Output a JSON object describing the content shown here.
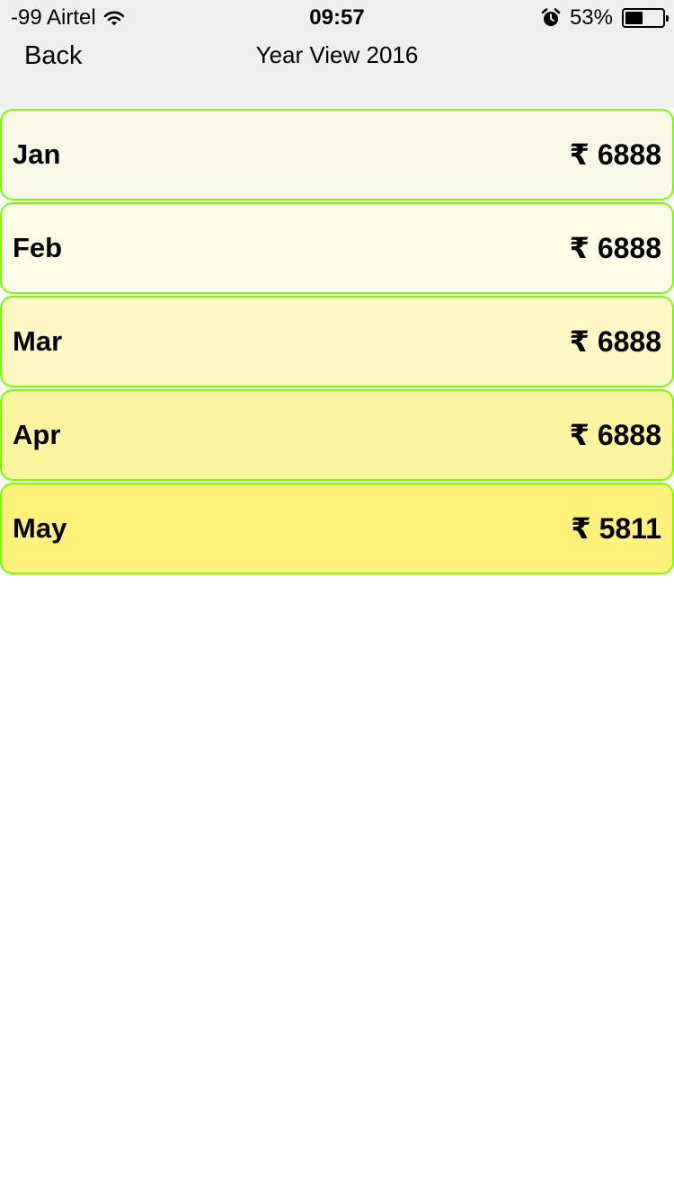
{
  "status_bar": {
    "carrier": "-99 Airtel",
    "time": "09:57",
    "battery_percent_text": "53%",
    "battery_level": 0.53,
    "icons": [
      "wifi-icon",
      "alarm-icon",
      "battery-icon"
    ]
  },
  "nav": {
    "back_label": "Back",
    "title": "Year View 2016"
  },
  "colors": {
    "row_border": "#7cfc00",
    "header_bg": "#efefef",
    "row_backgrounds": [
      "#f8f8e6",
      "#fefde8",
      "#fdf8c4",
      "#fdf49f",
      "#fff17a"
    ]
  },
  "months": [
    {
      "name": "Jan",
      "amount": "₹ 6888"
    },
    {
      "name": "Feb",
      "amount": "₹ 6888"
    },
    {
      "name": "Mar",
      "amount": "₹ 6888"
    },
    {
      "name": "Apr",
      "amount": "₹ 6888"
    },
    {
      "name": "May",
      "amount": "₹ 5811"
    }
  ]
}
